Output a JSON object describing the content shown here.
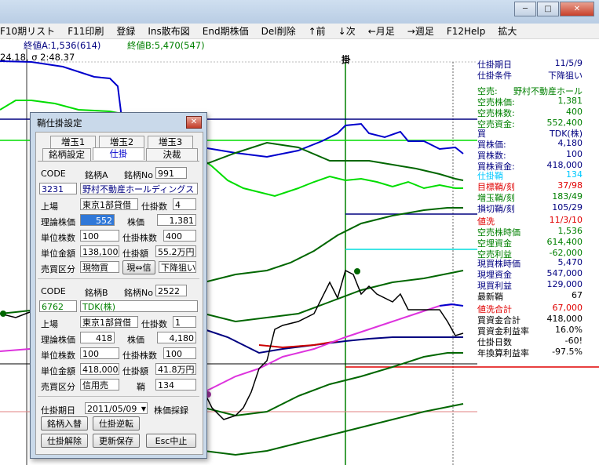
{
  "window": {
    "minimize": "─",
    "maximize": "□",
    "close": "✕"
  },
  "menu": [
    "F10期リスト",
    "F11印刷",
    "登録",
    "Ins散布図",
    "End期株価",
    "Del削除",
    "↑前",
    "↓次",
    "←月足",
    "→週足",
    "F12Help",
    "拡大"
  ],
  "top": {
    "line1_a": "終値A:1,536(614)",
    "line1_b": "終値B:5,470(547)",
    "line2": "24.18, σ 2:48.37",
    "marker": "掛"
  },
  "panel": [
    {
      "label": "仕掛期日",
      "value": "11/5/9",
      "color": "#000080"
    },
    {
      "label": "仕掛条件",
      "value": "下降狙い",
      "color": "#000080"
    },
    {
      "label": "空売:",
      "value": "野村不動産ホール",
      "color": "#008000"
    },
    {
      "label": "空売株価:",
      "value": "1,381",
      "color": "#008000"
    },
    {
      "label": "空売株数:",
      "value": "400",
      "color": "#008000"
    },
    {
      "label": "空売資金:",
      "value": "552,400",
      "color": "#008000"
    },
    {
      "label": "買",
      "value": "TDK(株)",
      "color": "#000080"
    },
    {
      "label": "買株価:",
      "value": "4,180",
      "color": "#000080"
    },
    {
      "label": "買株数:",
      "value": "100",
      "color": "#000080"
    },
    {
      "label": "買株資金:",
      "value": "418,000",
      "color": "#000080"
    },
    {
      "label": "仕掛鞘",
      "value": "134",
      "color": "#00c8ff"
    },
    {
      "label": "目標鞘/刻",
      "value": "37/98",
      "color": "#e00000"
    },
    {
      "label": "増玉鞘/刻",
      "value": "183/49",
      "color": "#008000"
    },
    {
      "label": "損切鞘/刻",
      "value": "105/29",
      "color": "#000080"
    },
    {
      "label": "値洗",
      "value": "11/3/10",
      "color": "#e00000"
    },
    {
      "label": "空売株時価",
      "value": "1,536",
      "color": "#008000"
    },
    {
      "label": "空埋資金",
      "value": "614,400",
      "color": "#008000"
    },
    {
      "label": "空売利益",
      "value": "-62,000",
      "color": "#008000"
    },
    {
      "label": "現買株時価",
      "value": "5,470",
      "color": "#000080"
    },
    {
      "label": "現埋資金",
      "value": "547,000",
      "color": "#000080"
    },
    {
      "label": "現買利益",
      "value": "129,000",
      "color": "#000080"
    },
    {
      "label": "最新鞘",
      "value": "67",
      "color": "#000000"
    },
    {
      "label": "値洗合計",
      "value": "67,000",
      "color": "#e00000"
    },
    {
      "label": "買資金合計",
      "value": "418,000",
      "color": "#000000"
    },
    {
      "label": "買資金利益率",
      "value": "16.0%",
      "color": "#000000"
    },
    {
      "label": "仕掛日数",
      "value": "-60!",
      "color": "#000000"
    },
    {
      "label": "年換算利益率",
      "value": "-97.5%",
      "color": "#000000"
    }
  ],
  "dialog": {
    "title": "鞘仕掛設定",
    "close": "✕",
    "tabs_row1": [
      "増玉1",
      "増玉2",
      "増玉3"
    ],
    "tabs_row2": [
      "銘柄設定",
      "仕掛",
      "決裁"
    ],
    "a": {
      "code_label": "CODE",
      "meigara_label": "銘柄A",
      "no_label": "銘柄No",
      "no": "991",
      "code": "3231",
      "name": "野村不動産ホールディングス",
      "ichiba_label": "上場",
      "ichiba": "東京1部貸借",
      "kabusu_label": "仕掛数",
      "kabusu": "4",
      "riron_label": "理論株価",
      "riron": "552",
      "kabuka_label": "株価",
      "kabuka": "1,381",
      "tani_label": "単位株数",
      "tani": "100",
      "shikake_kabusu_label": "仕掛株数",
      "shikake_kabusu": "400",
      "kingaku_label": "単位金額",
      "kingaku": "138,100",
      "shikake_gaku_label": "仕掛額",
      "shikake_gaku": "55.2万円",
      "kubun_label": "売買区分",
      "kubun": "現物買",
      "swap": "現⇔信",
      "jouken": "下降狙い"
    },
    "b": {
      "code_label": "CODE",
      "meigara_label": "銘柄B",
      "no_label": "銘柄No",
      "no": "2522",
      "code": "6762",
      "name": "TDK(株)",
      "ichiba_label": "上場",
      "ichiba": "東京1部貸借",
      "kabusu_label": "仕掛数",
      "kabusu": "1",
      "riron_label": "理論株価",
      "riron": "418",
      "kabuka_label": "株価",
      "kabuka": "4,180",
      "tani_label": "単位株数",
      "tani": "100",
      "shikake_kabusu_label": "仕掛株数",
      "shikake_kabusu": "100",
      "kingaku_label": "単位金額",
      "kingaku": "418,000",
      "shikake_gaku_label": "仕掛額",
      "shikake_gaku": "41.8万円",
      "kubun_label": "売買区分",
      "kubun": "信用売",
      "saya_label": "鞘",
      "saya": "134"
    },
    "date_label": "仕掛期日",
    "date": "2011/05/09",
    "date_arrow": "▼",
    "saiyou": "株価採録",
    "buttons": {
      "swap_stock": "銘柄入替",
      "reverse": "仕掛逆転",
      "cancel_pos": "仕掛解除",
      "update": "更新保存",
      "esc": "Esc中止"
    }
  }
}
